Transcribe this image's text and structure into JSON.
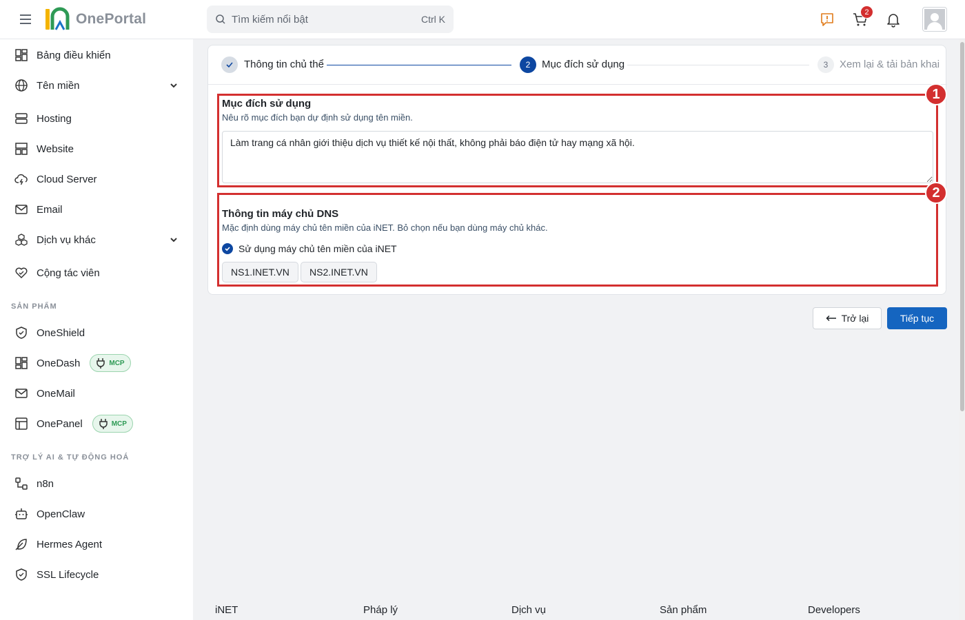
{
  "header": {
    "logo_text": "OnePortal",
    "search_placeholder": "Tìm kiếm nổi bật",
    "search_shortcut": "Ctrl K",
    "cart_count": "2"
  },
  "sidebar": {
    "items": [
      {
        "label": "Bảng điều khiển"
      },
      {
        "label": "Tên miền"
      },
      {
        "label": "Hosting"
      },
      {
        "label": "Website"
      },
      {
        "label": "Cloud Server"
      },
      {
        "label": "Email"
      },
      {
        "label": "Dịch vụ khác"
      },
      {
        "label": "Cộng tác viên"
      }
    ],
    "section_products": "SẢN PHẨM",
    "products": [
      {
        "label": "OneShield"
      },
      {
        "label": "OneDash",
        "badge": "MCP"
      },
      {
        "label": "OneMail"
      },
      {
        "label": "OnePanel",
        "badge": "MCP"
      }
    ],
    "section_ai": "TRỢ LÝ AI & TỰ ĐỘNG HOÁ",
    "ai": [
      {
        "label": "n8n"
      },
      {
        "label": "OpenClaw"
      },
      {
        "label": "Hermes Agent"
      },
      {
        "label": "SSL Lifecycle"
      }
    ]
  },
  "stepper": {
    "step1": {
      "label": "Thông tin chủ thể"
    },
    "step2": {
      "number": "2",
      "label": "Mục đích sử dụng"
    },
    "step3": {
      "number": "3",
      "label": "Xem lại & tải bản khai"
    }
  },
  "purpose": {
    "title": "Mục đích sử dụng",
    "subtitle": "Nêu rõ mục đích bạn dự định sử dụng tên miền.",
    "value": "Làm trang cá nhân giới thiệu dịch vụ thiết kế nội thất, không phải báo điện tử hay mạng xã hội."
  },
  "dns": {
    "title": "Thông tin máy chủ DNS",
    "subtitle": "Mặc định dùng máy chủ tên miền của iNET. Bỏ chọn nếu bạn dùng máy chủ khác.",
    "checkbox_label": "Sử dụng máy chủ tên miền của iNET",
    "checked": true,
    "servers": [
      "NS1.INET.VN",
      "NS2.INET.VN"
    ]
  },
  "annotations": [
    "1",
    "2"
  ],
  "buttons": {
    "back": "Trở lại",
    "next": "Tiếp tục"
  },
  "footer": {
    "columns": [
      "iNET",
      "Pháp lý",
      "Dịch vụ",
      "Sản phẩm",
      "Developers"
    ]
  },
  "colors": {
    "accent": "#1565c0",
    "step_active": "#0d47a1",
    "annotation": "#d32f2f",
    "mcp_green": "#2e9a55"
  }
}
